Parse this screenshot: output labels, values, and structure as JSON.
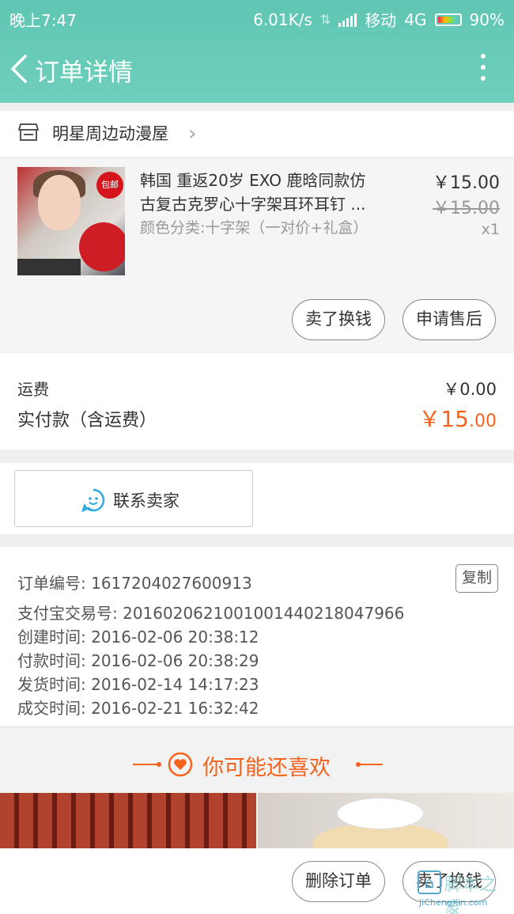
{
  "status": {
    "time": "晚上7:47",
    "speed": "6.01K/s",
    "carrier": "移动",
    "network": "4G",
    "battery": "90%"
  },
  "header": {
    "title": "订单详情",
    "back_icon": "chevron-left-icon",
    "more_icon": "more-vertical-icon",
    "bg_color": "#66cbb7"
  },
  "shop": {
    "name": "明星周边动漫屋",
    "icon": "store-icon"
  },
  "item": {
    "title_line1": "韩国 重返20岁 EXO 鹿晗同款仿",
    "title_line2": "古复古克罗心十字架耳环耳钉 ...",
    "sku": "颜色分类:十字架（一对价+礼盒）",
    "price": "￥15.00",
    "original_price": "￥15.00",
    "quantity": "x1",
    "badge": "包邮",
    "actions": [
      "卖了换钱",
      "申请售后"
    ]
  },
  "fees": {
    "shipping_label": "运费",
    "shipping_value": "￥0.00",
    "paid_label": "实付款（含运费）",
    "paid_main": "￥15",
    "paid_decimal": ".00",
    "accent_color": "#f5621c"
  },
  "contact": {
    "label": "联系卖家",
    "icon": "chat-bubble-icon"
  },
  "order_info": {
    "copy_label": "复制",
    "rows": [
      "订单编号: 1617204027600913",
      "支付宝交易号: 2016020621001001440218047966",
      "创建时间: 2016-02-06 20:38:12",
      "付款时间: 2016-02-06 20:38:29",
      "发货时间: 2016-02-14 14:17:23",
      "成交时间: 2016-02-21 16:32:42"
    ]
  },
  "recommend": {
    "title": "你可能还喜欢",
    "icon": "heart-icon"
  },
  "bottom": {
    "actions": [
      "删除订单",
      "卖了换钱"
    ]
  },
  "watermark": {
    "text_cn": "脚本之家",
    "text_en": "JiChengXin.com"
  }
}
